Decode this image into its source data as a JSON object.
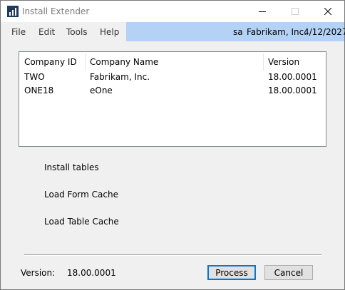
{
  "window": {
    "title": "Install Extender",
    "app_icon": "chart-bars-icon",
    "controls": [
      "minimize-icon",
      "maximize-icon",
      "close-icon"
    ]
  },
  "menu": {
    "items": [
      "File",
      "Edit",
      "Tools",
      "Help"
    ]
  },
  "company_strip": {
    "user": "sa",
    "company": "Fabrikam, Inc.",
    "date": "4/12/2027",
    "background": "#b4d2f5"
  },
  "company_list": {
    "columns": [
      "Company ID",
      "Company Name",
      "Version"
    ],
    "rows": [
      {
        "id": "TWO",
        "name": "Fabrikam, Inc.",
        "version": "18.00.0001"
      },
      {
        "id": "ONE18",
        "name": "eOne",
        "version": "18.00.0001"
      }
    ]
  },
  "options": [
    "Install tables",
    "Load Form Cache",
    "Load Table Cache"
  ],
  "footer": {
    "version_label": "Version:",
    "version_value": "18.00.0001",
    "process_label": "Process",
    "cancel_label": "Cancel"
  }
}
